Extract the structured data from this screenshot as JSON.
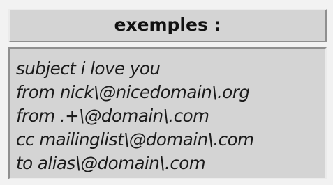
{
  "panel": {
    "title": "exemples :",
    "lines": [
      "subject i love you",
      "from nick\\@nicedomain\\.org",
      "from .+\\@domain\\.com",
      "cc mailinglist\\@domain\\.com",
      "to alias\\@domain\\.com"
    ]
  }
}
